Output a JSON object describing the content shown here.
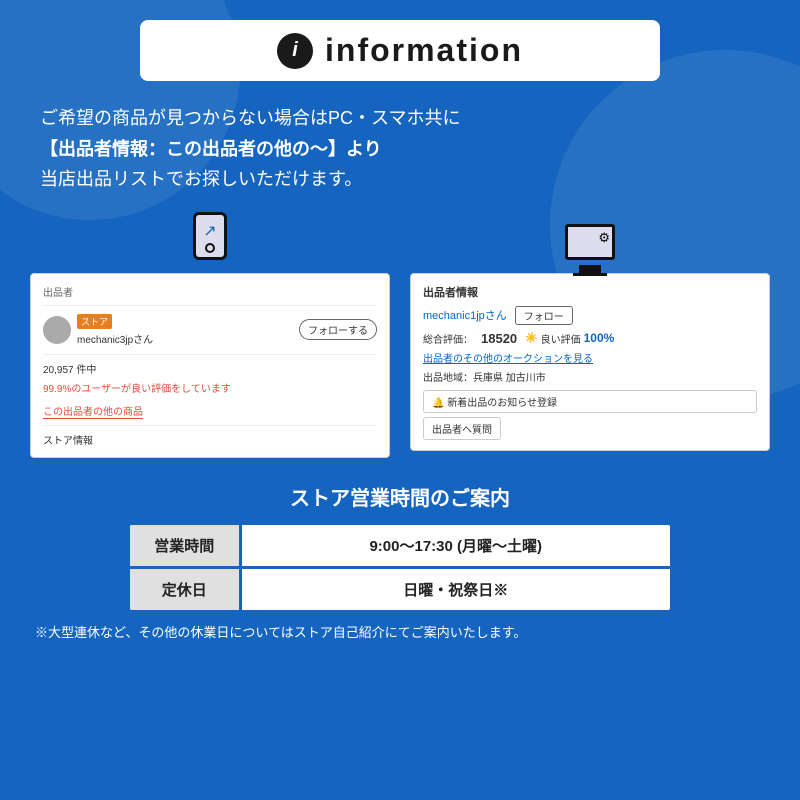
{
  "header": {
    "title": "information",
    "icon_label": "i"
  },
  "description": {
    "line1": "ご希望の商品が見つからない場合はPC・スマホ共に",
    "line2": "【出品者情報：この出品者の他の〜】より",
    "line3": "当店出品リストでお探しいただけます。"
  },
  "mobile_screenshot": {
    "section_label": "出品者",
    "store_badge": "ストア",
    "seller_name": "mechanic3jpさん",
    "follow_button": "フォローする",
    "count": "20,957 件中",
    "positive_rate": "99.9%のユーザーが良い評価をしています",
    "other_items_link": "この出品者の他の商品",
    "store_info_label": "ストア情報"
  },
  "pc_screenshot": {
    "section_label": "出品者情報",
    "seller_name": "mechanic1jpさん",
    "follow_button": "フォロー",
    "rating_label": "総合評価：",
    "rating_value": "18520",
    "good_label": "良い評価",
    "good_pct": "100%",
    "auction_link": "出品者のその他のオークションを見る",
    "location_label": "出品地域：兵庫県 加古川市",
    "notify_button": "🔔 新着出品のお知らせ登録",
    "question_button": "出品者へ質問"
  },
  "store_hours": {
    "title": "ストア営業時間のご案内",
    "rows": [
      {
        "label": "営業時間",
        "value": "9:00〜17:30 (月曜〜土曜)"
      },
      {
        "label": "定休日",
        "value": "日曜・祝祭日※"
      }
    ],
    "footer_note": "※大型連休など、その他の休業日についてはストア自己紹介にてご案内いたします。"
  },
  "colors": {
    "background": "#1565c0",
    "white": "#ffffff",
    "accent_red": "#e74c3c",
    "accent_blue": "#0066cc"
  }
}
